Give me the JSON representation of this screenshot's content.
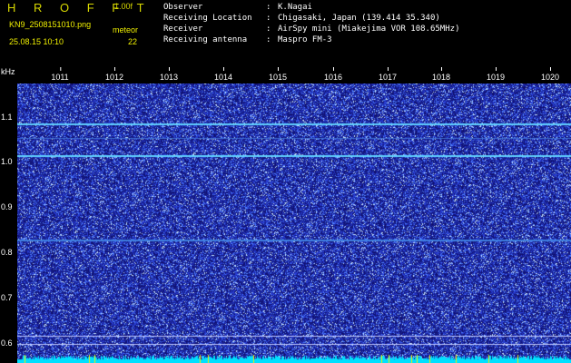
{
  "header": {
    "title": "H R O F F T",
    "version": "1.00f",
    "filename": "KN9_2508151010.png",
    "timestamp": "25.08.15 10:10",
    "meteor_label": "meteor",
    "meteor_count": "22"
  },
  "info": [
    {
      "key": "Observer",
      "value": "K.Nagai"
    },
    {
      "key": "Receiving Location",
      "value": "Chigasaki, Japan (139.414 35.340)"
    },
    {
      "key": "Receiver",
      "value": "AirSpy mini (Miakejima VOR 108.65MHz)"
    },
    {
      "key": "Receiving antenna",
      "value": "Maspro FM-3"
    }
  ],
  "info_colon": ":",
  "axis": {
    "y_unit": "kHz",
    "x_ticks": [
      "1011",
      "1012",
      "1013",
      "1014",
      "1015",
      "1016",
      "1017",
      "1018",
      "1019",
      "1020"
    ],
    "y_ticks": [
      "1.1",
      "1.0",
      "0.9",
      "0.8",
      "0.7",
      "0.6"
    ]
  },
  "colors": {
    "background": "#000000",
    "spectrum": "#101070",
    "noise": "#3a4cff",
    "carrier": "#60d0ff",
    "accent": "#f0f000",
    "baseline": "#00e0ff"
  }
}
